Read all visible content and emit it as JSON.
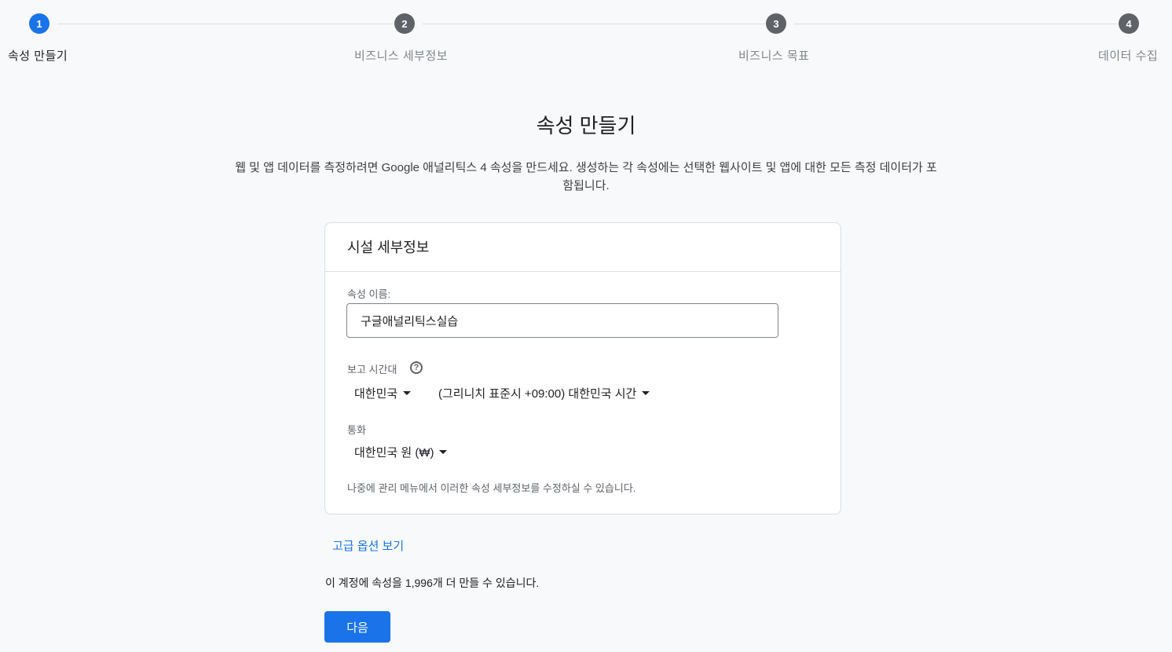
{
  "stepper": {
    "steps": [
      {
        "number": "1",
        "label": "속성 만들기",
        "active": true
      },
      {
        "number": "2",
        "label": "비즈니스 세부정보",
        "active": false
      },
      {
        "number": "3",
        "label": "비즈니스 목표",
        "active": false
      },
      {
        "number": "4",
        "label": "데이터 수집",
        "active": false
      }
    ]
  },
  "page": {
    "title": "속성 만들기",
    "description": "웹 및 앱 데이터를 측정하려면 Google 애널리틱스 4 속성을 만드세요. 생성하는 각 속성에는 선택한 웹사이트 및 앱에 대한 모든 측정 데이터가 포함됩니다."
  },
  "card": {
    "title": "시설 세부정보",
    "property_name_label": "속성 이름:",
    "property_name_value": "구글애널리틱스실습",
    "timezone_label": "보고 시간대",
    "help_icon_glyph": "?",
    "timezone_country": "대한민국",
    "timezone_value": "(그리니치 표준시 +09:00) 대한민국 시간",
    "currency_label": "통화",
    "currency_value": "대한민국 원 (₩)",
    "hint": "나중에 관리 메뉴에서 이러한 속성 세부정보를 수정하실 수 있습니다."
  },
  "advanced_link": "고급 옵션 보기",
  "remaining_text": "이 계정에 속성을 1,996개 더 만들 수 있습니다.",
  "next_button": "다음",
  "colors": {
    "accent": "#1a73e8",
    "inactive_step": "#5f6368",
    "background": "#f8f9fa"
  }
}
